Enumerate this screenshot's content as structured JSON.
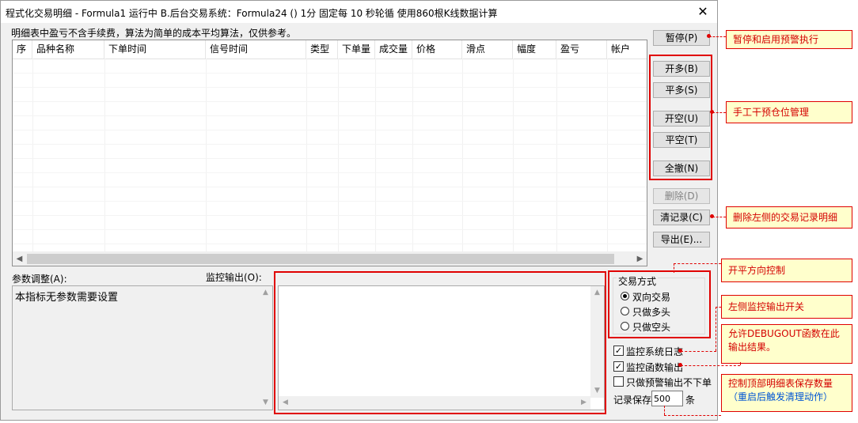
{
  "window": {
    "title": "程式化交易明细 - Formula1 运行中  B.后台交易系统：Formula24 () 1分 固定每 10 秒轮循 使用860根K线数据计算"
  },
  "note_top": "明细表中盈亏不含手续费，算法为简单的成本平均算法，仅供参考。",
  "table": {
    "columns": [
      "序",
      "品种名称",
      "下单时间",
      "信号时间",
      "类型",
      "下单量",
      "成交量",
      "价格",
      "滑点",
      "幅度",
      "盈亏",
      "帐户"
    ]
  },
  "buttons": {
    "pause": "暂停(P)",
    "open_long": "开多(B)",
    "close_long": "平多(S)",
    "open_short": "开空(U)",
    "close_short": "平空(T)",
    "cancel_all": "全撤(N)",
    "delete": "删除(D)",
    "clear": "清记录(C)",
    "export": "导出(E)..."
  },
  "params": {
    "label": "参数调整(A):",
    "text": "本指标无参数需要设置"
  },
  "monitor": {
    "label": "监控输出(O):"
  },
  "trade_mode": {
    "title": "交易方式",
    "options": [
      {
        "label": "双向交易",
        "selected": true
      },
      {
        "label": "只做多头",
        "selected": false
      },
      {
        "label": "只做空头",
        "selected": false
      }
    ]
  },
  "checks": [
    {
      "label": "监控系统日志",
      "checked": true
    },
    {
      "label": "监控函数输出",
      "checked": true
    },
    {
      "label": "只做预警输出不下单",
      "checked": false
    }
  ],
  "record": {
    "prefix": "记录保存",
    "value": "500",
    "suffix": "条"
  },
  "annotations": {
    "pause": "暂停和启用预警执行",
    "manual": "手工干预仓位管理",
    "clear": "删除左侧的交易记录明细",
    "direction": "开平方向控制",
    "monitor_switch": "左侧监控输出开关",
    "debugout_1": "允许DEBUGOUT函数在此",
    "debugout_2": "输出结果。",
    "record_1": "控制顶部明细表保存数量",
    "record_2": "（重启后触发清理动作）"
  },
  "colors": {
    "annotation_red": "#e00000",
    "note_bg": "#ffffcc",
    "note_blue": "#0055d4"
  }
}
